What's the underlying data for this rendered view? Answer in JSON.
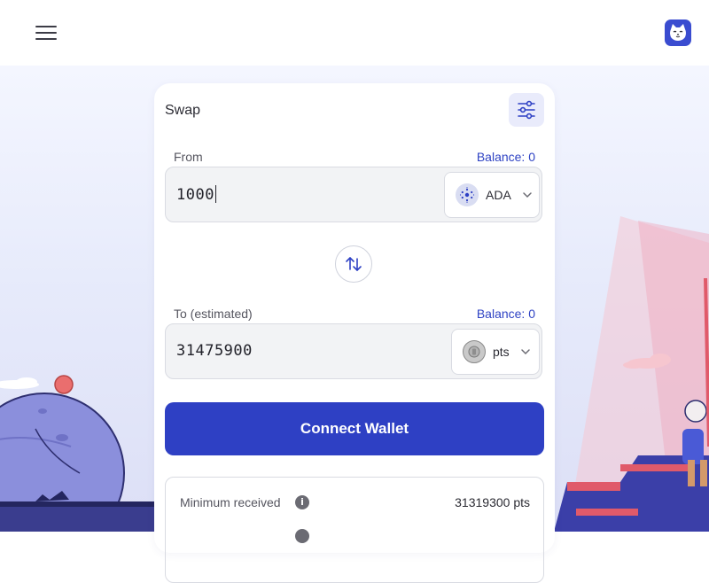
{
  "header": {
    "menu_icon": "hamburger-menu-icon",
    "logo_icon": "cat-face-logo-icon"
  },
  "swap": {
    "title": "Swap",
    "settings_icon": "sliders-settings-icon",
    "from": {
      "label": "From",
      "balance": "Balance: 0",
      "amount": "1000",
      "token": "ADA",
      "token_icon": "cardano-icon"
    },
    "switch_icon": "swap-arrows-icon",
    "to": {
      "label": "To (estimated)",
      "balance": "Balance: 0",
      "amount": "31475900",
      "token": "pts",
      "token_icon": "coin-icon"
    },
    "connect_label": "Connect Wallet",
    "details": {
      "minimum_received_label": "Minimum received",
      "minimum_received_value": "31319300 pts"
    }
  },
  "colors": {
    "accent": "#2e40c4",
    "balance_text": "#2f43c4",
    "logo_bg": "#3a4cd0"
  }
}
